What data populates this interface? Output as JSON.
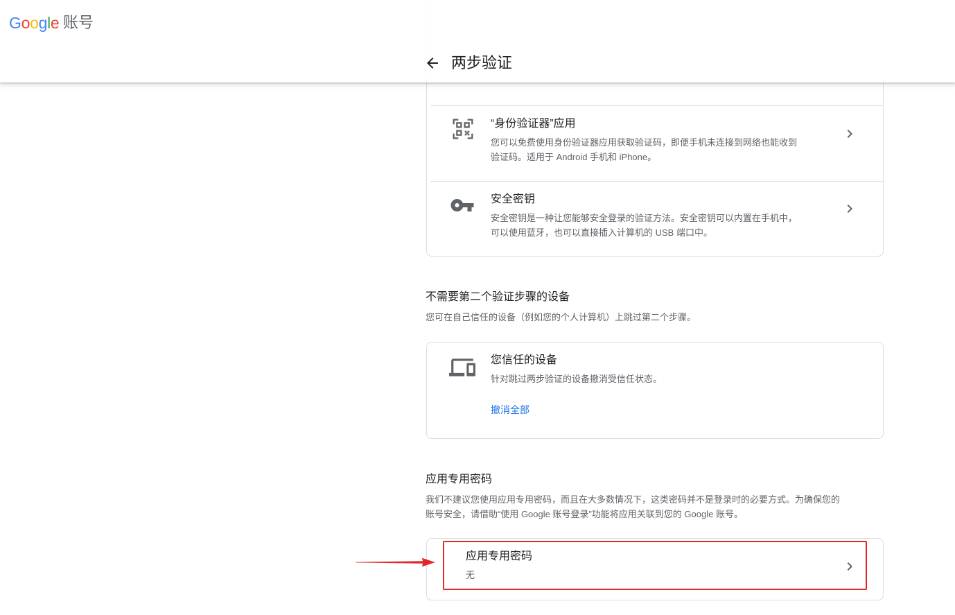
{
  "header": {
    "logo_letters": [
      "G",
      "o",
      "o",
      "g",
      "l",
      "e"
    ],
    "product": "账号",
    "page_title": "两步验证",
    "back_icon": "arrow-back-icon"
  },
  "second_step_options": {
    "items": [
      {
        "title": "“身份验证器”应用",
        "desc_lines": [
          "您可以免费使用身份验证器应用获取验证码，即便手机未连接到网络也能收到",
          "验证码。适用于 Android 手机和 iPhone。"
        ],
        "icon": "qr-code-icon"
      },
      {
        "title": "安全密钥",
        "desc_lines": [
          "安全密钥是一种让您能够安全登录的验证方法。安全密钥可以内置在手机中，",
          "可以使用蓝牙，也可以直接插入计算机的 USB 端口中。"
        ],
        "icon": "key-icon"
      }
    ]
  },
  "trusted_devices_section": {
    "heading": "不需要第二个验证步骤的设备",
    "subtitle": "您可在自己信任的设备（例如您的个人计算机）上跳过第二个步骤。",
    "card": {
      "title": "您信任的设备",
      "desc": "针对跳过两步验证的设备撤消受信任状态。",
      "link": "撤消全部",
      "icon": "devices-icon"
    }
  },
  "app_passwords_section": {
    "heading": "应用专用密码",
    "desc_lines": [
      "我们不建议您使用应用专用密码，而且在大多数情况下，这类密码并不是登录时的必要方式。为确保您的",
      "账号安全，请借助“使用 Google 账号登录”功能将应用关联到您的 Google 账号。"
    ],
    "card": {
      "title": "应用专用密码",
      "value": "无"
    }
  },
  "colors": {
    "logo_letters": [
      "#4285F4",
      "#EA4335",
      "#FBBC05",
      "#4285F4",
      "#34A853",
      "#EA4335"
    ],
    "text_primary": "#202124",
    "text_secondary": "#5f6368",
    "link": "#1a73e8",
    "icon": "#5f6368",
    "annotation_red": "#e0272a"
  }
}
